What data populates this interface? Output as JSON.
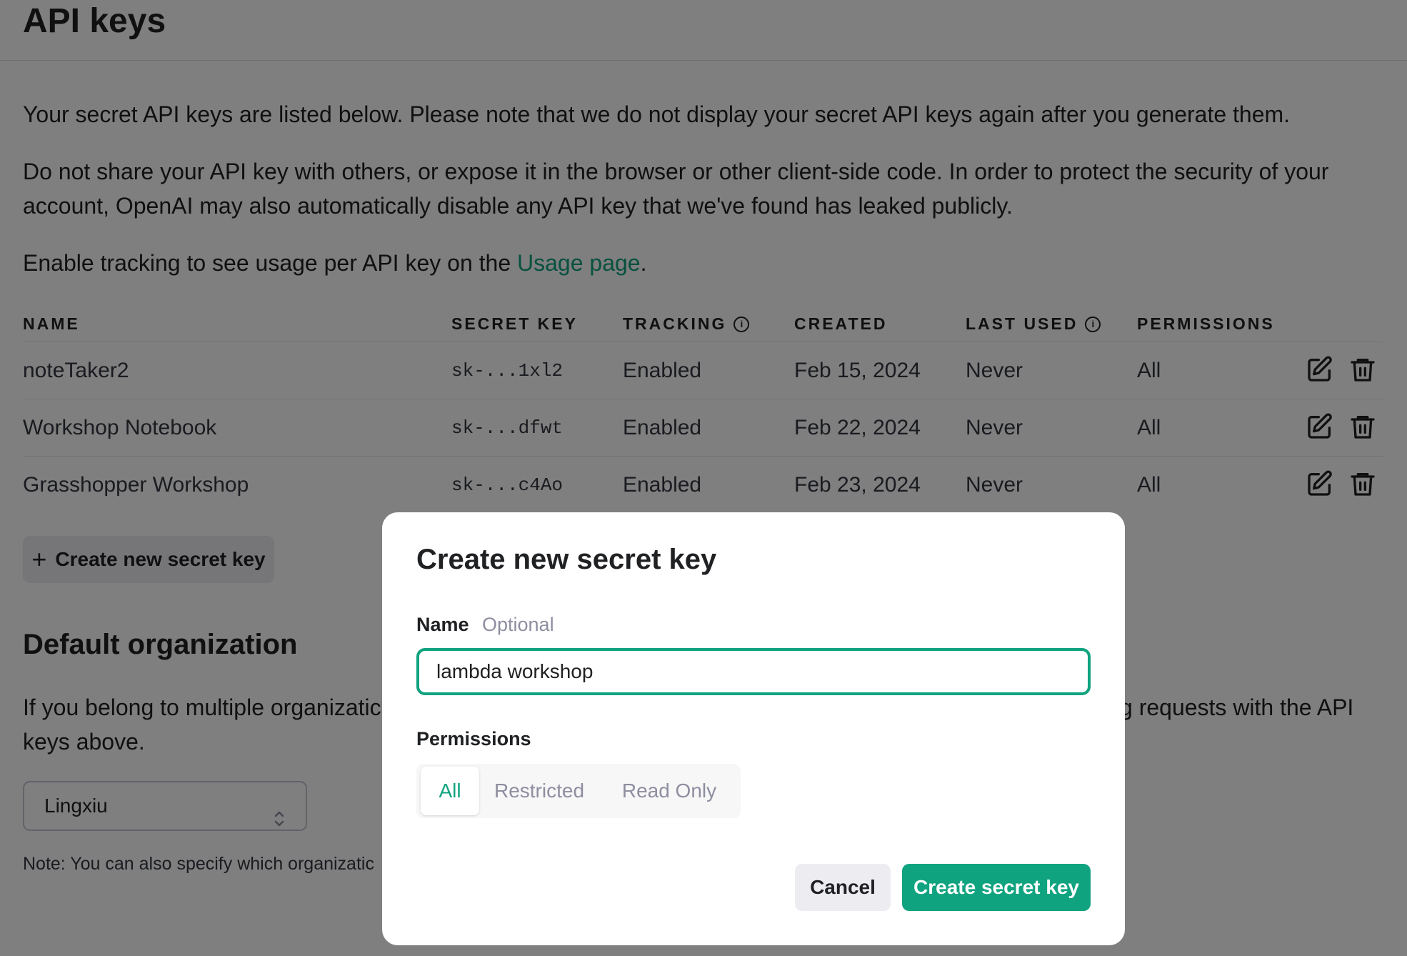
{
  "page": {
    "title": "API keys",
    "intro": "Your secret API keys are listed below. Please note that we do not display your secret API keys again after you generate them.",
    "warning": "Do not share your API key with others, or expose it in the browser or other client-side code. In order to protect the security of your account, OpenAI may also automatically disable any API key that we've found has leaked publicly.",
    "tracking_prefix": "Enable tracking to see usage per API key on the ",
    "tracking_link": "Usage page",
    "tracking_suffix": "."
  },
  "table": {
    "headers": {
      "name": "NAME",
      "secret_key": "SECRET KEY",
      "tracking": "TRACKING",
      "created": "CREATED",
      "last_used": "LAST USED",
      "permissions": "PERMISSIONS"
    },
    "rows": [
      {
        "name": "noteTaker2",
        "key": "sk-...1xl2",
        "tracking": "Enabled",
        "created": "Feb 15, 2024",
        "last_used": "Never",
        "permissions": "All"
      },
      {
        "name": "Workshop Notebook",
        "key": "sk-...dfwt",
        "tracking": "Enabled",
        "created": "Feb 22, 2024",
        "last_used": "Never",
        "permissions": "All"
      },
      {
        "name": "Grasshopper Workshop",
        "key": "sk-...c4Ao",
        "tracking": "Enabled",
        "created": "Feb 23, 2024",
        "last_used": "Never",
        "permissions": "All"
      }
    ]
  },
  "create_button": {
    "icon": "plus-icon",
    "label": "Create new secret key"
  },
  "default_org": {
    "title": "Default organization",
    "description_start": "If you belong to multiple organizatic",
    "description_end": "g requests with the API",
    "description_line2": "keys above.",
    "selected": "Lingxiu",
    "note": "Note: You can also specify which organizatic"
  },
  "modal": {
    "title": "Create new secret key",
    "name_label": "Name",
    "name_optional": "Optional",
    "name_value": "lambda workshop",
    "permissions_label": "Permissions",
    "permission_options": [
      "All",
      "Restricted",
      "Read Only"
    ],
    "selected_permission": "All",
    "cancel_label": "Cancel",
    "submit_label": "Create secret key"
  },
  "colors": {
    "accent": "#10a37f",
    "text": "#202123",
    "muted": "#8e8ea0",
    "button_gray": "#ececf1"
  }
}
